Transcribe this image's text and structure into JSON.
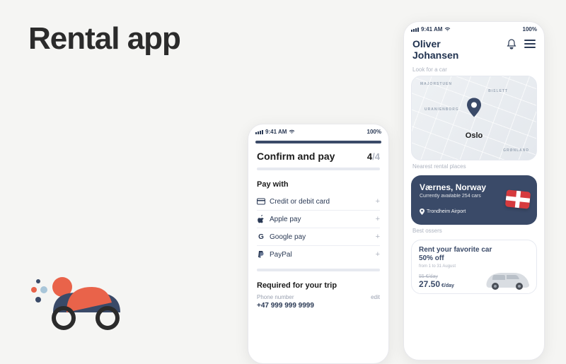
{
  "title": "Rental app",
  "status": {
    "time": "9:41 AM",
    "battery": "100%"
  },
  "checkout": {
    "heading": "Confirm and pay",
    "step_current": "4",
    "step_total": "/4",
    "paywith_heading": "Pay with",
    "options": [
      {
        "label": "Credit or debit card"
      },
      {
        "label": "Apple pay"
      },
      {
        "label": "Google pay"
      },
      {
        "label": "PayPal"
      }
    ],
    "required_heading": "Required for your trip",
    "phone_label": "Phone number",
    "phone_value": "+47 999 999 9999",
    "edit": "edit"
  },
  "home": {
    "username_first": "Oliver",
    "username_last": "Johansen",
    "look_label": "Look for a car",
    "map": {
      "city": "Oslo",
      "districts": [
        "MAJORSTUEN",
        "BISLETT",
        "URANIENBORG",
        "GRØNLAND"
      ]
    },
    "nearest_label": "Nearest rental places",
    "nearest_card": {
      "title": "Værnes, Norway",
      "subtitle": "Currently available 254 cars",
      "location": "Trondheim Airport"
    },
    "offers_label": "Best ossers",
    "offer": {
      "line1": "Rent your favorite car",
      "line2": "50% off",
      "dates": "from 1 to 31 August",
      "old_price": "55 €/day",
      "price": "27.50",
      "price_unit": " €/day"
    }
  }
}
